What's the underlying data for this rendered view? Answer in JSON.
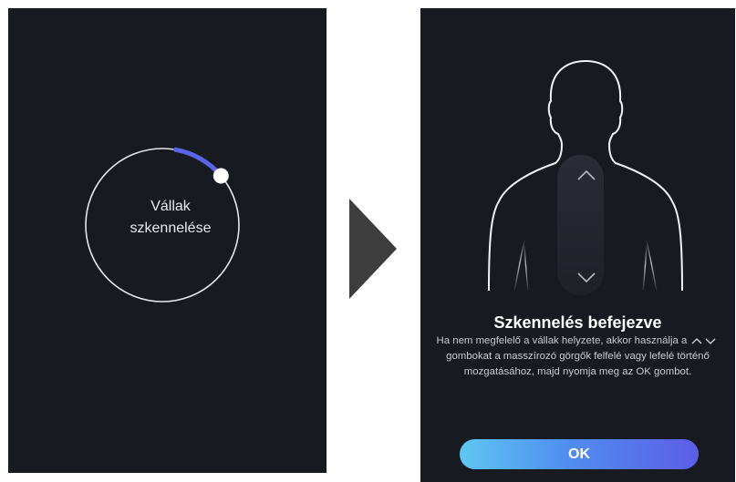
{
  "scan_screen": {
    "label_line1": "Vállak",
    "label_line2": "szkennelése",
    "progress_fraction": 0.1
  },
  "result_screen": {
    "title": "Szkennelés befejezve",
    "text_before_icons": "Ha nem megfelelő a vállak helyzete, akkor használja a",
    "text_after_icons": "gombokat a masszírozó görgők felfelé vagy lefelé történő mozgatásához, majd nyomja meg az OK gombot.",
    "ok_label": "OK"
  },
  "icons": {
    "transition": "play-triangle-icon",
    "up": "chevron-up-icon",
    "down": "chevron-down-icon",
    "inline": "up-down-arrows-icon"
  },
  "colors": {
    "screen_bg": "#181a22",
    "progress_accent": "#5b63e6",
    "arrow": "#3d3d3d",
    "button_gradient_start": "#5fc6f3",
    "button_gradient_end": "#5d5de6"
  }
}
